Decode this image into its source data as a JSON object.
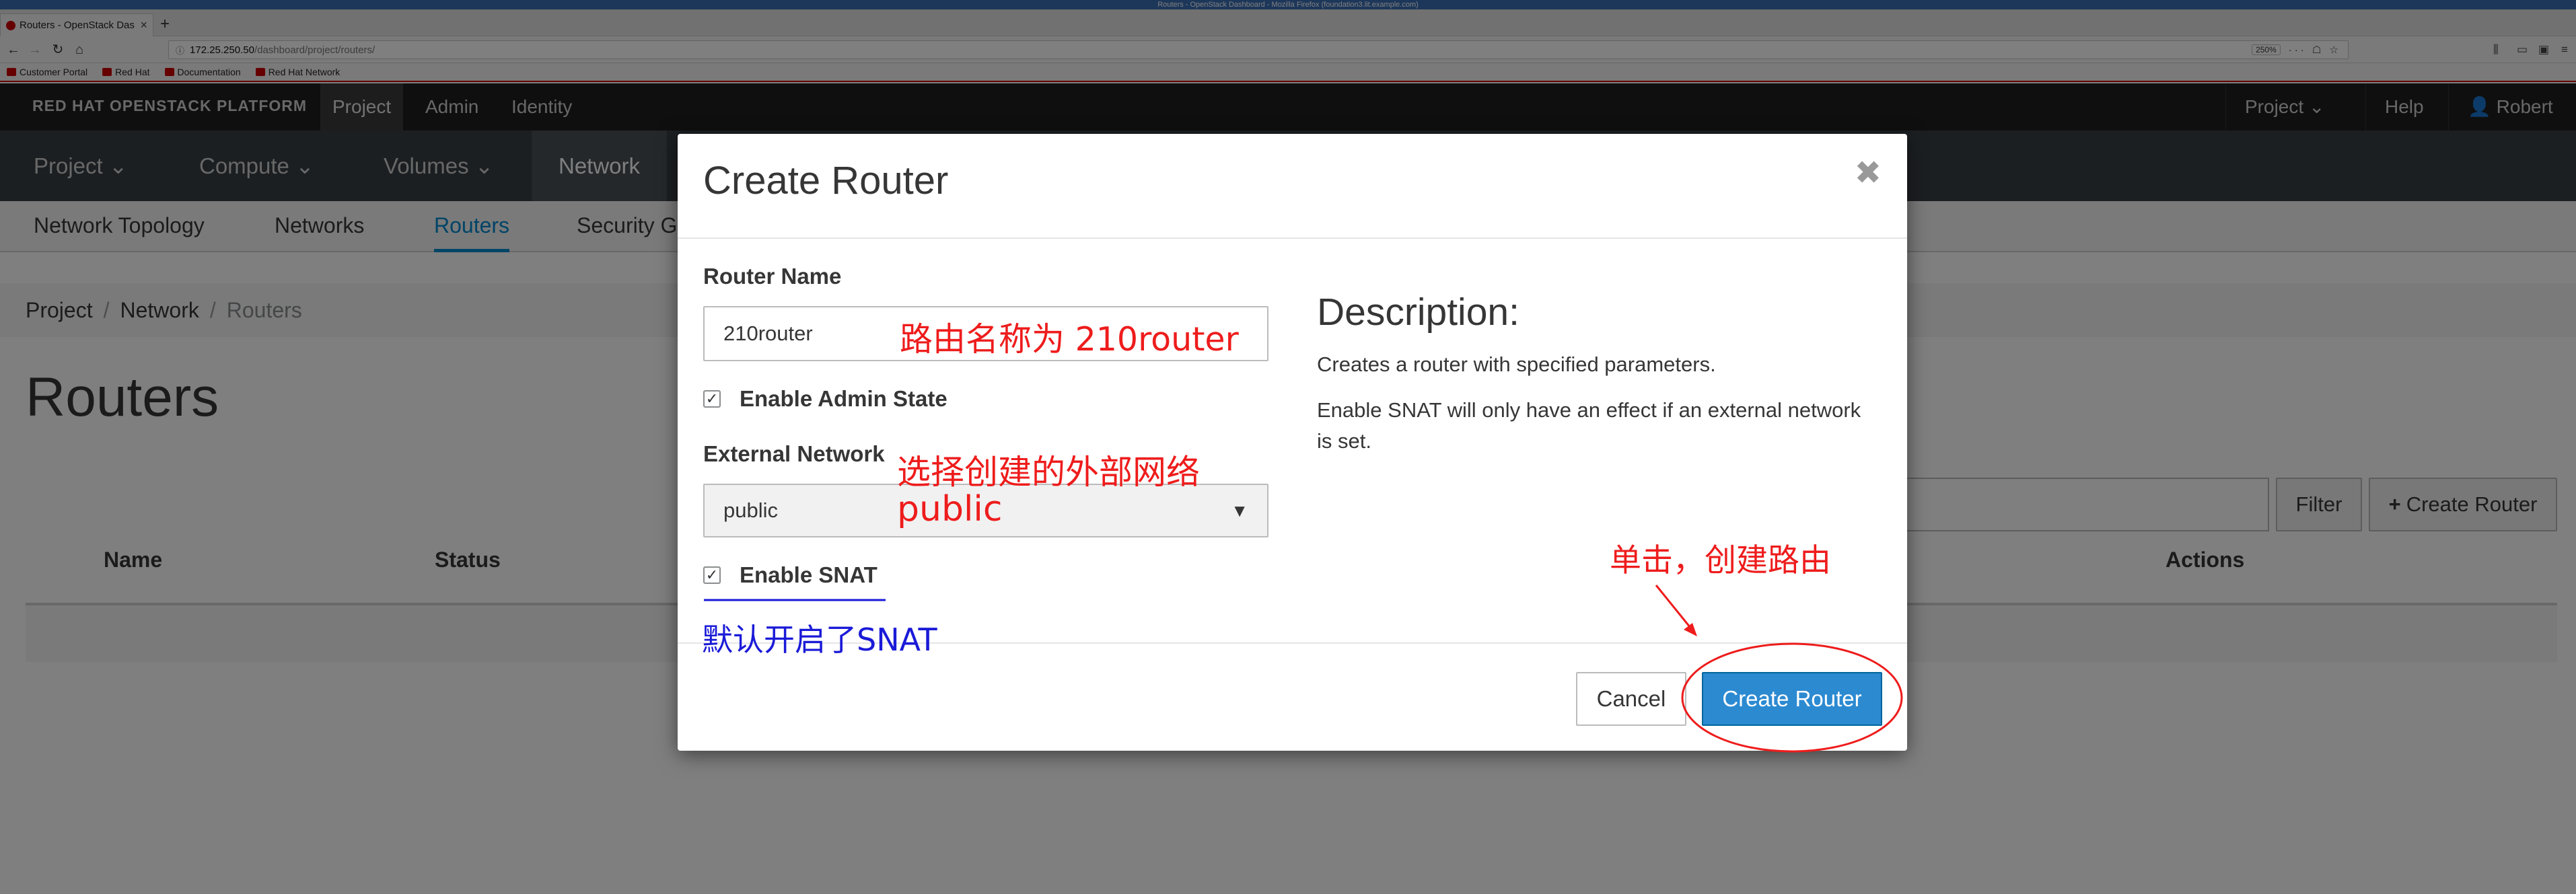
{
  "window": {
    "title": "Routers - OpenStack Dashboard - Mozilla Firefox (foundation3.lit.example.com)"
  },
  "browser": {
    "tab_title": "Routers - OpenStack Das",
    "url_host": "172.25.250.50",
    "url_path": "/dashboard/project/routers/",
    "zoom": "250%",
    "bookmarks": [
      "Customer Portal",
      "Red Hat",
      "Documentation",
      "Red Hat Network"
    ]
  },
  "app": {
    "brand": "RED HAT OPENSTACK PLATFORM",
    "top_nav": [
      "Project",
      "Admin",
      "Identity"
    ],
    "top_right": {
      "project": "Project",
      "help": "Help",
      "user": "Robert"
    },
    "primary_nav": [
      "Project",
      "Compute",
      "Volumes",
      "Network"
    ],
    "secondary_nav": [
      "Network Topology",
      "Networks",
      "Routers",
      "Security G"
    ],
    "breadcrumb": [
      "Project",
      "Network",
      "Routers"
    ],
    "page_title": "Routers",
    "filter_button": "Filter",
    "create_router_button": "Create Router",
    "table_headers": {
      "name": "Name",
      "status": "Status",
      "actions": "Actions"
    }
  },
  "modal": {
    "title": "Create Router",
    "router_name_label": "Router Name",
    "router_name_value": "210router",
    "enable_admin_state_label": "Enable Admin State",
    "external_network_label": "External Network",
    "external_network_value": "public",
    "enable_snat_label": "Enable SNAT",
    "description_title": "Description:",
    "description_line1": "Creates a router with specified parameters.",
    "description_line2": "Enable SNAT will only have an effect if an external network is set.",
    "cancel_button": "Cancel",
    "create_button": "Create Router"
  },
  "annotations": {
    "router_name_note": "路由名称为 210router",
    "external_network_note_line1": "选择创建的外部网络",
    "external_network_note_line2": "public",
    "snat_note": "默认开启了SNAT",
    "click_note": "单击，创建路由"
  },
  "colors": {
    "annotation_red": "#ee1c1c",
    "annotation_blue": "#1a1ad8",
    "primary_button": "#2c8ad1",
    "active_tab_accent": "#0088ce",
    "masthead": "#1f1f1f"
  }
}
